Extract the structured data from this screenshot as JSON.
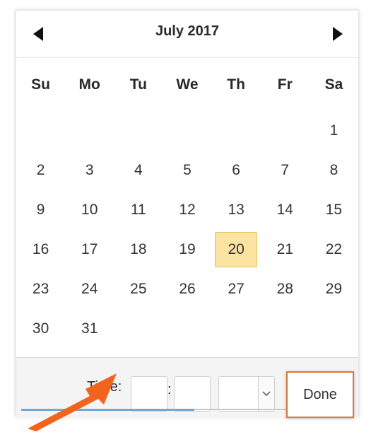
{
  "calendar": {
    "month_title": "July 2017",
    "prev_icon": "triangle-left-icon",
    "next_icon": "triangle-right-icon",
    "weekdays": [
      "Su",
      "Mo",
      "Tu",
      "We",
      "Th",
      "Fr",
      "Sa"
    ],
    "weeks": [
      [
        "",
        "",
        "",
        "",
        "",
        "",
        "1"
      ],
      [
        "2",
        "3",
        "4",
        "5",
        "6",
        "7",
        "8"
      ],
      [
        "9",
        "10",
        "11",
        "12",
        "13",
        "14",
        "15"
      ],
      [
        "16",
        "17",
        "18",
        "19",
        "20",
        "21",
        "22"
      ],
      [
        "23",
        "24",
        "25",
        "26",
        "27",
        "28",
        "29"
      ],
      [
        "30",
        "31",
        "",
        "",
        "",
        "",
        ""
      ]
    ],
    "highlighted_day": "20",
    "highlight_color": "#fbe4a2"
  },
  "time": {
    "label": "Time:",
    "separator": ":",
    "hour_value": "",
    "minute_value": "",
    "ampm_value": "",
    "dropdown_icon": "chevron-down-icon"
  },
  "actions": {
    "done_label": "Done"
  },
  "annotation": {
    "arrow_icon": "pointer-arrow-icon",
    "arrow_color": "#f0641e",
    "callout_border_color": "#d77a3e"
  }
}
